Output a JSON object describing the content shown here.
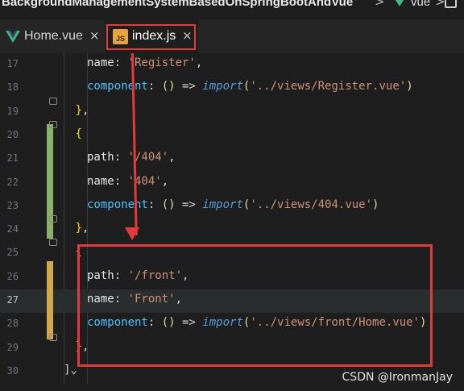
{
  "breadcrumb": {
    "project": "BackgroundManagementSystemBasedOnSpringBootAndVue",
    "separator": ">",
    "folder": "vue",
    "separator2": ">"
  },
  "tabs": [
    {
      "label": "Home.vue",
      "close": "×",
      "icon": "vue-icon"
    },
    {
      "label": "index.js",
      "close": "×",
      "icon": "js-file-icon",
      "icon_text": "JS",
      "active": true
    }
  ],
  "editor": {
    "lines": [
      {
        "n": "17",
        "indent": "    ",
        "parts": [
          [
            "prop",
            "name"
          ],
          [
            "punc",
            ": "
          ],
          [
            "str",
            "'Register'"
          ],
          [
            "punc",
            ","
          ]
        ]
      },
      {
        "n": "18",
        "indent": "    ",
        "parts": [
          [
            "key",
            "component"
          ],
          [
            "punc",
            ": "
          ],
          [
            "paren",
            "()"
          ],
          [
            "arrow",
            " => "
          ],
          [
            "import",
            "import"
          ],
          [
            "paren",
            "("
          ],
          [
            "str",
            "'../views/Register.vue'"
          ],
          [
            "paren",
            ")"
          ]
        ]
      },
      {
        "n": "19",
        "indent": "  ",
        "parts": [
          [
            "brace",
            "}"
          ],
          [
            "punc",
            ","
          ]
        ]
      },
      {
        "n": "20",
        "indent": "  ",
        "parts": [
          [
            "brace",
            "{"
          ]
        ]
      },
      {
        "n": "21",
        "indent": "    ",
        "parts": [
          [
            "prop",
            "path"
          ],
          [
            "punc",
            ": "
          ],
          [
            "str",
            "'/404'"
          ],
          [
            "punc",
            ","
          ]
        ]
      },
      {
        "n": "22",
        "indent": "    ",
        "parts": [
          [
            "prop",
            "name"
          ],
          [
            "punc",
            ": "
          ],
          [
            "str",
            "'404'"
          ],
          [
            "punc",
            ","
          ]
        ]
      },
      {
        "n": "23",
        "indent": "    ",
        "parts": [
          [
            "key",
            "component"
          ],
          [
            "punc",
            ": "
          ],
          [
            "paren",
            "()"
          ],
          [
            "arrow",
            " => "
          ],
          [
            "import",
            "import"
          ],
          [
            "paren",
            "("
          ],
          [
            "str",
            "'../views/404.vue'"
          ],
          [
            "paren",
            ")"
          ]
        ]
      },
      {
        "n": "24",
        "indent": "  ",
        "parts": [
          [
            "brace",
            "}"
          ],
          [
            "punc",
            ","
          ]
        ]
      },
      {
        "n": "25",
        "indent": "  ",
        "parts": [
          [
            "brace",
            "{"
          ]
        ]
      },
      {
        "n": "26",
        "indent": "    ",
        "parts": [
          [
            "prop",
            "path"
          ],
          [
            "punc",
            ": "
          ],
          [
            "str",
            "'/front'"
          ],
          [
            "punc",
            ","
          ]
        ]
      },
      {
        "n": "27",
        "indent": "    ",
        "parts": [
          [
            "prop",
            "name"
          ],
          [
            "punc",
            ": "
          ],
          [
            "str",
            "'Front'"
          ],
          [
            "punc",
            ","
          ]
        ]
      },
      {
        "n": "28",
        "indent": "    ",
        "parts": [
          [
            "key",
            "component"
          ],
          [
            "punc",
            ": "
          ],
          [
            "paren",
            "()"
          ],
          [
            "arrow",
            " => "
          ],
          [
            "import",
            "import"
          ],
          [
            "paren",
            "("
          ],
          [
            "str",
            "'../views/front/Home.vue'"
          ],
          [
            "paren",
            ")"
          ]
        ]
      },
      {
        "n": "29",
        "indent": "  ",
        "parts": [
          [
            "brace",
            "}"
          ],
          [
            "punc",
            ","
          ]
        ]
      },
      {
        "n": "30",
        "indent": "",
        "parts": [
          [
            "fold",
            "]"
          ],
          [
            "squiggle",
            "⌄"
          ]
        ]
      }
    ],
    "active_line": "27"
  },
  "watermark": "CSDN @IronmanJay",
  "colors": {
    "annotation_red": "#e33b3b",
    "git_added": "#8ab26a",
    "git_modified": "#cfa84f"
  }
}
